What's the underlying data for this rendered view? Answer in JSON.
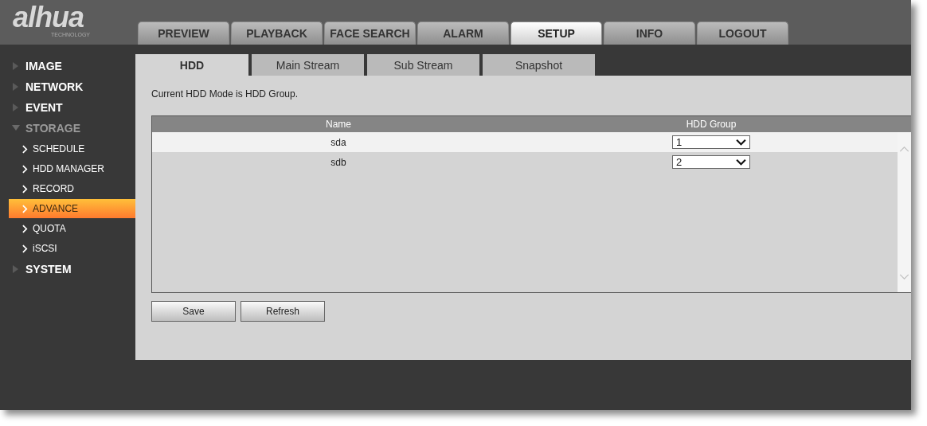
{
  "logo": {
    "name": "alhua",
    "tagline": "TECHNOLOGY"
  },
  "main_tabs": [
    {
      "label": "PREVIEW",
      "selected": false
    },
    {
      "label": "PLAYBACK",
      "selected": false
    },
    {
      "label": "FACE SEARCH",
      "selected": false
    },
    {
      "label": "ALARM",
      "selected": false
    },
    {
      "label": "SETUP",
      "selected": true
    },
    {
      "label": "INFO",
      "selected": false
    },
    {
      "label": "LOGOUT",
      "selected": false
    }
  ],
  "sidebar": {
    "items": [
      {
        "label": "IMAGE",
        "expanded": false
      },
      {
        "label": "NETWORK",
        "expanded": false
      },
      {
        "label": "EVENT",
        "expanded": false
      },
      {
        "label": "STORAGE",
        "expanded": true,
        "children": [
          {
            "label": "SCHEDULE",
            "selected": false
          },
          {
            "label": "HDD MANAGER",
            "selected": false
          },
          {
            "label": "RECORD",
            "selected": false
          },
          {
            "label": "ADVANCE",
            "selected": true
          },
          {
            "label": "QUOTA",
            "selected": false
          },
          {
            "label": "iSCSI",
            "selected": false
          }
        ]
      },
      {
        "label": "SYSTEM",
        "expanded": false
      }
    ]
  },
  "sub_tabs": [
    {
      "label": "HDD",
      "selected": true
    },
    {
      "label": "Main Stream",
      "selected": false
    },
    {
      "label": "Sub Stream",
      "selected": false
    },
    {
      "label": "Snapshot",
      "selected": false
    }
  ],
  "message": "Current HDD Mode is HDD Group.",
  "table": {
    "columns": [
      "Name",
      "HDD Group"
    ],
    "rows": [
      {
        "name": "sda",
        "group": "1",
        "selected": true
      },
      {
        "name": "sdb",
        "group": "2",
        "selected": false
      }
    ]
  },
  "buttons": [
    "Save",
    "Refresh"
  ]
}
